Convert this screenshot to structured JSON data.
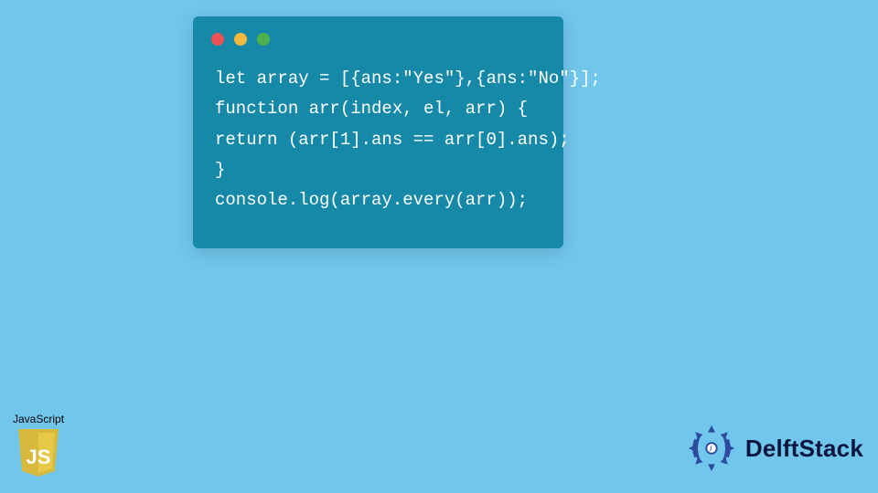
{
  "code": {
    "lines": [
      "let array = [{ans:\"Yes\"},{ans:\"No\"}];",
      "function arr(index, el, arr) {",
      "return (arr[1].ans == arr[0].ans);",
      "}",
      "console.log(array.every(arr));"
    ]
  },
  "jsBadge": {
    "label": "JavaScript",
    "shieldText": "JS"
  },
  "brand": {
    "name": "DelftStack"
  },
  "colors": {
    "pageBg": "#71c6ec",
    "windowBg": "#1789a8",
    "codeText": "#ffffff",
    "dotRed": "#ec5353",
    "dotYellow": "#f2b93c",
    "dotGreen": "#4bb14e",
    "shieldTop": "#d7b93e",
    "shieldBottom": "#e8c947",
    "brandColor": "#2e4a9e"
  }
}
